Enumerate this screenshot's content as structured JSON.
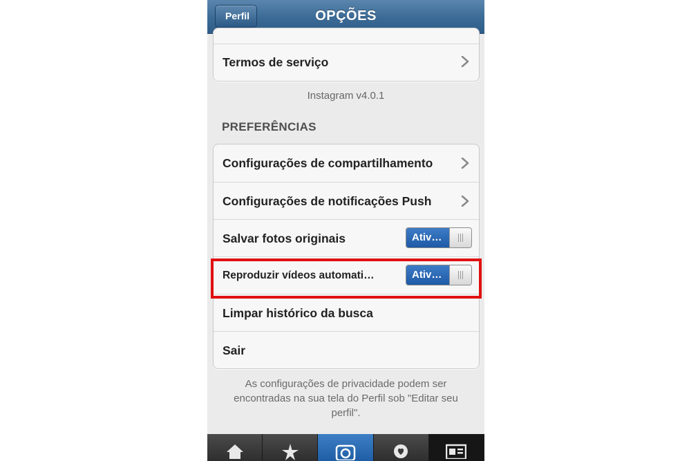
{
  "navbar": {
    "back_label": "Perfil",
    "title": "OPÇÕES"
  },
  "top_group": {
    "items": [
      {
        "label": "Termos de serviço"
      }
    ]
  },
  "version": "Instagram v4.0.1",
  "preferences": {
    "header": "PREFERÊNCIAS",
    "items": [
      {
        "label": "Configurações de compartilhamento"
      },
      {
        "label": "Configurações de notificações Push"
      },
      {
        "label": "Salvar fotos originais",
        "toggle_label": "Ativ…"
      },
      {
        "label": "Reproduzir vídeos automati…",
        "toggle_label": "Ativ…"
      },
      {
        "label": "Limpar histórico da busca"
      },
      {
        "label": "Sair"
      }
    ]
  },
  "footer_note": "As configurações de privacidade podem ser encontradas na sua tela do Perfil sob \"Editar seu perfil\".",
  "tabbar": {
    "tabs": [
      {
        "icon": "home-icon"
      },
      {
        "icon": "explore-star-icon"
      },
      {
        "icon": "camera-icon"
      },
      {
        "icon": "news-heart-icon"
      },
      {
        "icon": "profile-card-icon"
      }
    ]
  },
  "colors": {
    "nav_blue": "#3a6a95",
    "toggle_blue": "#1e5aa6",
    "highlight_red": "#e01010"
  }
}
